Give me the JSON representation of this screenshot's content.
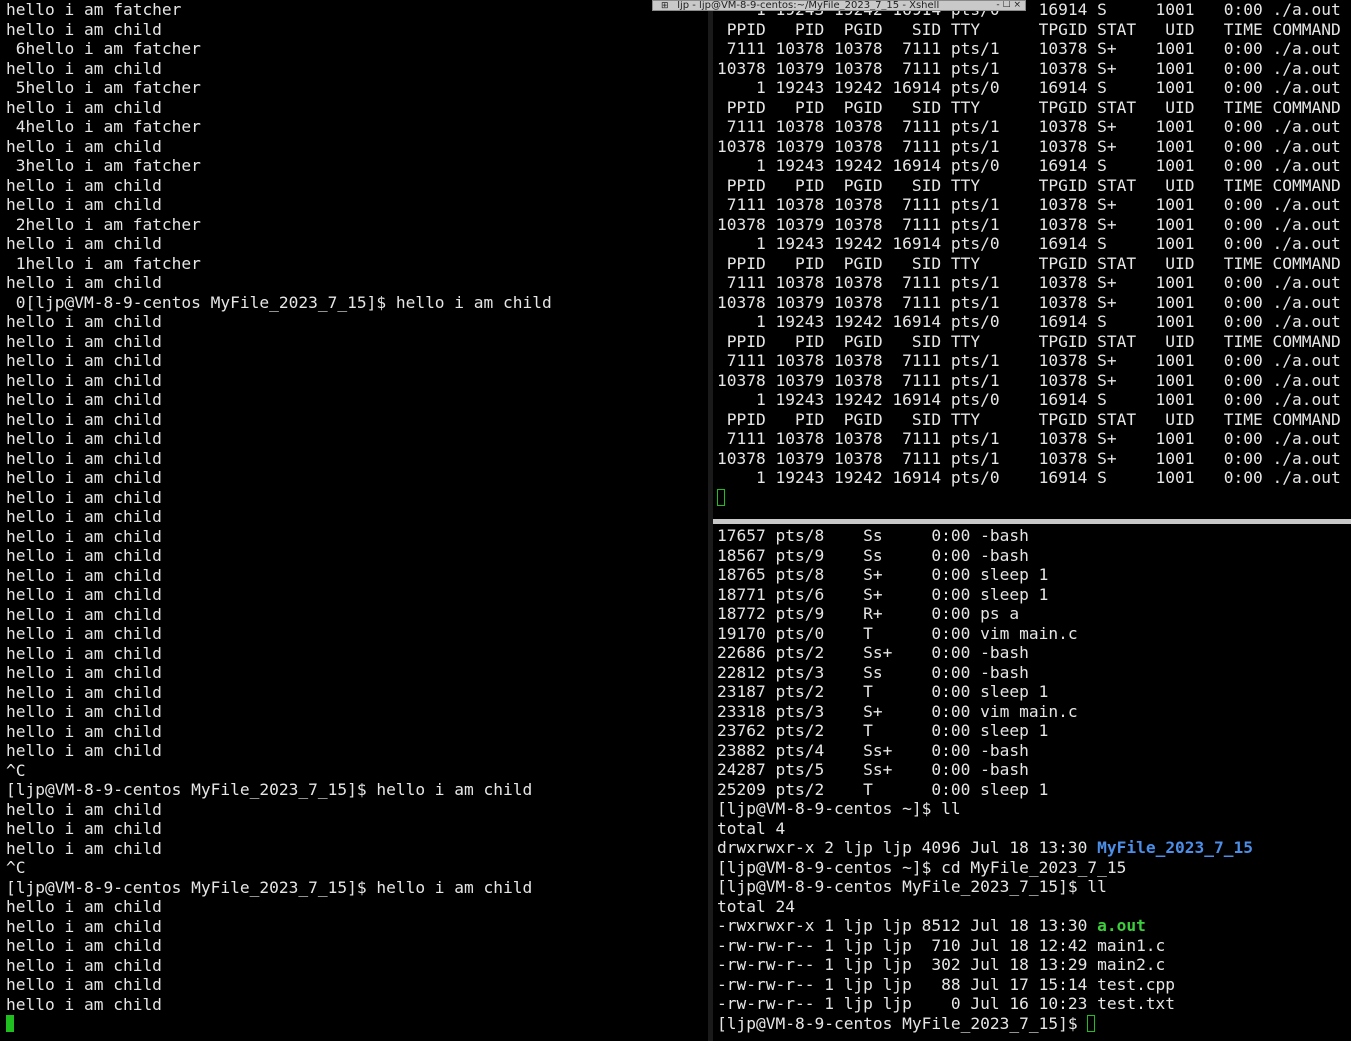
{
  "window": {
    "title": "ljp - ljp@VM-8-9-centos:~/MyFile_2023_7_15 - Xshell",
    "controls": "- ☐ ×"
  },
  "left_pane": {
    "lines": [
      "hello i am fatcher",
      "hello i am child",
      " 6hello i am fatcher",
      "hello i am child",
      " 5hello i am fatcher",
      "hello i am child",
      " 4hello i am fatcher",
      "hello i am child",
      " 3hello i am fatcher",
      "hello i am child",
      "hello i am child",
      " 2hello i am fatcher",
      "hello i am child",
      " 1hello i am fatcher",
      "hello i am child",
      " 0[ljp@VM-8-9-centos MyFile_2023_7_15]$ hello i am child",
      "hello i am child",
      "hello i am child",
      "hello i am child",
      "hello i am child",
      "hello i am child",
      "hello i am child",
      "hello i am child",
      "hello i am child",
      "hello i am child",
      "hello i am child",
      "hello i am child",
      "hello i am child",
      "hello i am child",
      "hello i am child",
      "hello i am child",
      "hello i am child",
      "hello i am child",
      "hello i am child",
      "hello i am child",
      "hello i am child",
      "hello i am child",
      "hello i am child",
      "hello i am child",
      "^C",
      "[ljp@VM-8-9-centos MyFile_2023_7_15]$ hello i am child",
      "hello i am child",
      "hello i am child",
      "hello i am child",
      "^C",
      "[ljp@VM-8-9-centos MyFile_2023_7_15]$ hello i am child",
      "hello i am child",
      "hello i am child",
      "hello i am child",
      "hello i am child",
      "hello i am child",
      "hello i am child"
    ]
  },
  "top_right_pane": {
    "lines": [
      "    1 19243 19242 16914 pts/0    16914 S     1001   0:00 ./a.out",
      " PPID   PID  PGID   SID TTY      TPGID STAT   UID   TIME COMMAND",
      " 7111 10378 10378  7111 pts/1    10378 S+    1001   0:00 ./a.out",
      "10378 10379 10378  7111 pts/1    10378 S+    1001   0:00 ./a.out",
      "    1 19243 19242 16914 pts/0    16914 S     1001   0:00 ./a.out",
      " PPID   PID  PGID   SID TTY      TPGID STAT   UID   TIME COMMAND",
      " 7111 10378 10378  7111 pts/1    10378 S+    1001   0:00 ./a.out",
      "10378 10379 10378  7111 pts/1    10378 S+    1001   0:00 ./a.out",
      "    1 19243 19242 16914 pts/0    16914 S     1001   0:00 ./a.out",
      " PPID   PID  PGID   SID TTY      TPGID STAT   UID   TIME COMMAND",
      " 7111 10378 10378  7111 pts/1    10378 S+    1001   0:00 ./a.out",
      "10378 10379 10378  7111 pts/1    10378 S+    1001   0:00 ./a.out",
      "    1 19243 19242 16914 pts/0    16914 S     1001   0:00 ./a.out",
      " PPID   PID  PGID   SID TTY      TPGID STAT   UID   TIME COMMAND",
      " 7111 10378 10378  7111 pts/1    10378 S+    1001   0:00 ./a.out",
      "10378 10379 10378  7111 pts/1    10378 S+    1001   0:00 ./a.out",
      "    1 19243 19242 16914 pts/0    16914 S     1001   0:00 ./a.out",
      " PPID   PID  PGID   SID TTY      TPGID STAT   UID   TIME COMMAND",
      " 7111 10378 10378  7111 pts/1    10378 S+    1001   0:00 ./a.out",
      "10378 10379 10378  7111 pts/1    10378 S+    1001   0:00 ./a.out",
      "    1 19243 19242 16914 pts/0    16914 S     1001   0:00 ./a.out",
      " PPID   PID  PGID   SID TTY      TPGID STAT   UID   TIME COMMAND",
      " 7111 10378 10378  7111 pts/1    10378 S+    1001   0:00 ./a.out",
      "10378 10379 10378  7111 pts/1    10378 S+    1001   0:00 ./a.out",
      "    1 19243 19242 16914 pts/0    16914 S     1001   0:00 ./a.out"
    ]
  },
  "bottom_right_pane": {
    "ps_lines": [
      "17657 pts/8    Ss     0:00 -bash",
      "18567 pts/9    Ss     0:00 -bash",
      "18765 pts/8    S+     0:00 sleep 1",
      "18771 pts/6    S+     0:00 sleep 1",
      "18772 pts/9    R+     0:00 ps a",
      "19170 pts/0    T      0:00 vim main.c",
      "22686 pts/2    Ss+    0:00 -bash",
      "22812 pts/3    Ss     0:00 -bash",
      "23187 pts/2    T      0:00 sleep 1",
      "23318 pts/3    S+     0:00 vim main.c",
      "23762 pts/2    T      0:00 sleep 1",
      "23882 pts/4    Ss+    0:00 -bash",
      "24287 pts/5    Ss+    0:00 -bash",
      "25209 pts/2    T      0:00 sleep 1",
      "[ljp@VM-8-9-centos ~]$ ll",
      "total 4"
    ],
    "dir_line_prefix": "drwxrwxr-x 2 ljp ljp 4096 Jul 18 13:30 ",
    "dir_name": "MyFile_2023_7_15",
    "cmd_lines": [
      "[ljp@VM-8-9-centos ~]$ cd MyFile_2023_7_15",
      "[ljp@VM-8-9-centos MyFile_2023_7_15]$ ll",
      "total 24"
    ],
    "exe_line_prefix": "-rwxrwxr-x 1 ljp ljp 8512 Jul 18 13:30 ",
    "exe_name": "a.out",
    "file_lines": [
      "-rw-rw-r-- 1 ljp ljp  710 Jul 18 12:42 main1.c",
      "-rw-rw-r-- 1 ljp ljp  302 Jul 18 13:29 main2.c",
      "-rw-rw-r-- 1 ljp ljp   88 Jul 17 15:14 test.cpp",
      "-rw-rw-r-- 1 ljp ljp    0 Jul 16 10:23 test.txt"
    ],
    "prompt": "[ljp@VM-8-9-centos MyFile_2023_7_15]$ "
  },
  "colors": {
    "background": "#000000",
    "text": "#e6e6e6",
    "directory": "#4c8ee8",
    "executable": "#3ccf3c",
    "cursor": "#1fbf1f"
  }
}
